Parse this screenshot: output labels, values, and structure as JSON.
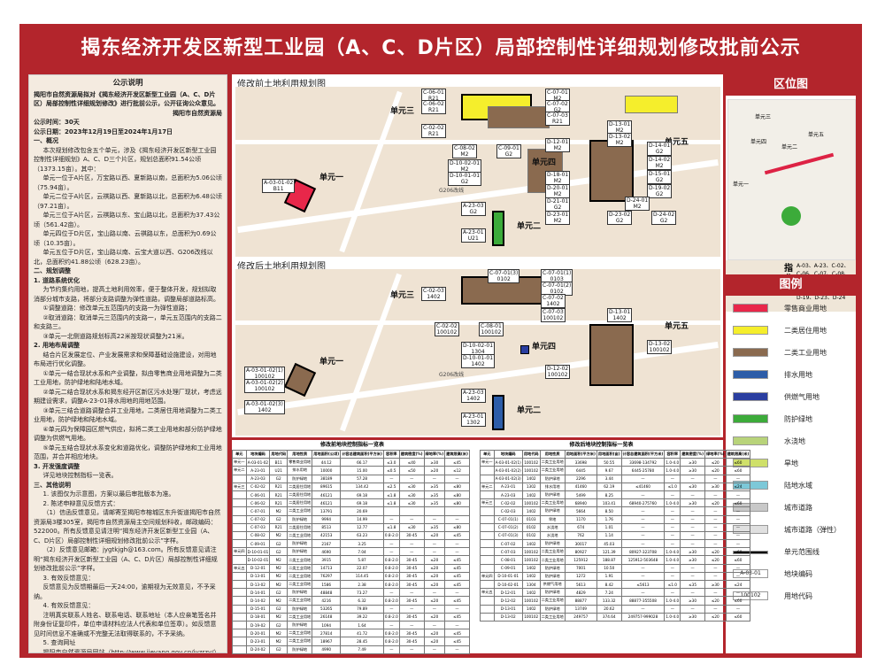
{
  "title": "揭东经济开发区新型工业园（A、C、D片区）局部控制性详细规划修改批前公示",
  "notice": {
    "heading": "公示说明",
    "intro": "揭阳市自然资源局拟对《揭东经济开发区新型工业园（A、C、D片区）局部控制性详细规划修改》进行批前公示，公开征询公众意见。",
    "issuer": "揭阳市自然资源局",
    "period_label": "公示时间：30天",
    "deadline": "公示日期：2023年12月19日至2024年1月17日",
    "sections": [
      {
        "h": "一、概况",
        "lines": [
          "本次规划修改包含五个单元，涉及《揭东经济开发区新型工业园控制性详细规划》A、C、D三个片区，规划总面积91.54公顷（1373.15亩）。其中：",
          "单元一位于A片区，万宝路以西、夏新路以南，总面积为5.06公顷（75.94亩）。",
          "单元二位于A片区，云祺路以西、夏新路以北，总面积为6.48公顷（97.21亩）。",
          "单元三位于A片区，云祺路以东、宝山路以北，总面积为37.43公顷（561.42亩）。",
          "单元四位于D片区，宝山路以南、云祺路以东，总面积为0.69公顷（10.35亩）。",
          "单元五位于D片区，宝山路以南、云宝大道以西、G206改线以北，总面积约41.88公顷（628.23亩）。"
        ]
      },
      {
        "h": "二、规划调整",
        "lines": []
      },
      {
        "h": "1. 道路系统优化",
        "lines": [
          "为节约集约用地，提高土地利用效率，便于整体开发，规划拟取消部分城市支路，将部分支路调整为弹性道路，调整局部道路标高。",
          "①调整道路：修改单元五范围内的支路一为弹性道路；",
          "②取消道路：取消单元三范围内的支路一，单元五范围内的支路二和支路三。",
          "③单元一北侧道路规划标高22米按现状调整为21米。"
        ]
      },
      {
        "h": "2. 用地布局调整",
        "lines": [
          "结合片区发展定位、产业发展需求和保障基础设施建设，对用地布局进行优化调整。",
          "①单元一结合现状水系和产业调整，拟由零售商业用地调整为二类工业用地，防护绿地和陆地水域。",
          "②单元二结合现状水系和揭东经开区新区污水处理厂现状，考虑远期建设需求，调整A-23-01排水用地的用地范围。",
          "③单元三结合道路调整合并工业用地，二类居住用地调整为二类工业用地，防护绿地和陆地水域。",
          "④单元四为保障园区燃气供应，拟将二类工业用地和部分防护绿地调整为供燃气用地。",
          "⑤单元五结合现状水系变化和道路优化，调整防护绿地和工业用地范围，并合并相应地块。"
        ]
      },
      {
        "h": "3. 开发强度调整",
        "lines": [
          "详见地块控制指标一览表。"
        ]
      },
      {
        "h": "三、其他说明",
        "lines": [
          "1. 该图仅为示意图，方案以最后审批版本为准。",
          "2. 陈述申辩意见反馈方式：",
          "（1）信函反馈意见，请邮寄至揭阳市榕城区东升街道揭阳市自然资源局3楼305室，揭阳市自然资源局主空间规划科收，邮政编码：522000。所有反馈意见请注明“揭东经济开发区新型工业园（A、C、D片区）局部控制性详细规划修改批前公示”字样。",
          "（2）反馈意见邮箱：jygtkjgh@163.com。所有反馈意见请注明“揭东经济开发区新型工业园（A、C、D片区）局部控制性详细规划修改批前公示”字样。",
          "3. 有效反馈意见：",
          "反馈意见为反馈期最后一天24:00，逾期视为无效意见，不予采纳。",
          "4. 有效反馈意见：",
          "注明真实联系人姓名、联系电话、联系地址（本人应亲笔签名并附身份证复印件，单位申请材料应法人代表和单位签章）。如反馈意见时间信息不准确或不完整无法取得联系的，不予采纳。",
          "5. 查询网址",
          "揭阳市自然资源局网站（http://www.jieyang.gov.cn/jyzrzy/）",
          "6. 本期公示图纸共1张，即本图。"
        ]
      }
    ]
  },
  "map_before": {
    "title": "修改前土地利用规划图",
    "units": [
      "单元一",
      "单元二",
      "单元三",
      "单元四",
      "单元五"
    ],
    "labels": [
      "C-06-01\nR21",
      "C-06-02\nR21",
      "C-02-02\nR21",
      "C-08-02\nM2",
      "C-09-01\nG2",
      "C-07-01\nM2",
      "C-07-02\nG2",
      "C-07-03\nR21",
      "D-13-01\nM2",
      "D-13-02\nM2",
      "D-14-01\nG2",
      "D-14-02\nM2",
      "D-12-01\nM2",
      "D-10-02-01\nM2",
      "D-10-01-01\nG2",
      "D-15-01\nG2",
      "D-19-02\nG2",
      "D-18-01\nM2",
      "D-20-01\nM2",
      "D-21-01\nG2",
      "D-23-01\nM2",
      "D-23-02\nG2",
      "D-24-01\nM2",
      "D-24-02\nG2",
      "A-03-01-02\nB11",
      "A-23-03\nG2",
      "A-23-01\nU21"
    ],
    "road": "G206改线"
  },
  "map_after": {
    "title": "修改后土地利用规划图",
    "units": [
      "单元一",
      "单元二",
      "单元三",
      "单元四",
      "单元五"
    ],
    "labels": [
      "C-07-01(3)\n0102",
      "C-07-01(1)\n0103",
      "C-02-03\n1402",
      "C-07-01(2)\n0102",
      "C-07-02\n1402",
      "C-07-03\n100102",
      "C-08-01\n100102",
      "C-02-02\n100102",
      "D-13-01\n1402",
      "D-13-02\n100102",
      "D-10-02-01\n1304",
      "D-10-01-01\n1402",
      "D-12-02\n100102",
      "A-03-01-02(1)\n100102",
      "A-03-01-02(2)\n100102",
      "A-03-01-02(3)\n1402",
      "A-23-03\n1402",
      "A-23-01\n1302"
    ],
    "road": "G206改线"
  },
  "location": {
    "title": "区位图",
    "units": [
      "单元三",
      "单元五",
      "单元二",
      "单元四",
      "单元一"
    ],
    "code_label": "编码",
    "north_label": "指北针",
    "codes": "A-03、A-23、C-02、C-06、C-07、C-08、C-09、D-10、D-12、D-13、D-14、D-18、D-19、D-23、D-24"
  },
  "legend": {
    "title": "图例",
    "items": [
      {
        "label": "零售商业用地",
        "color": "#e8274a"
      },
      {
        "label": "二类居住用地",
        "color": "#f5ee2c"
      },
      {
        "label": "二类工业用地",
        "color": "#8a6a4f"
      },
      {
        "label": "排水用地",
        "color": "#2d5da8"
      },
      {
        "label": "供燃气用地",
        "color": "#2a3ea0"
      },
      {
        "label": "防护绿地",
        "color": "#3cab3a"
      },
      {
        "label": "水浇地",
        "color": "#b8d37a"
      },
      {
        "label": "旱地",
        "color": "#cfe06a"
      },
      {
        "label": "陆地水域",
        "color": "#7dc8d8"
      },
      {
        "label": "城市道路",
        "color": "#c8c8c8"
      },
      {
        "label": "城市道路（弹性）",
        "color": "#e0e0e0"
      },
      {
        "label": "单元范围线",
        "color": "#000000"
      },
      {
        "label": "地块编码",
        "sample": "A-03-01"
      },
      {
        "label": "用地代码",
        "sample": "100102"
      }
    ]
  },
  "table_before": {
    "caption": "修改前地块控制指标一览表",
    "headers": [
      "单元",
      "地块编码",
      "用地代码",
      "用地性质",
      "用地面积(公顷)",
      "计容总建筑面积(平方米)",
      "容积率",
      "建筑密度(%)",
      "绿地率(%)",
      "建筑限高(米)"
    ],
    "rows": [
      [
        "单元一",
        "A-03-01-02",
        "B11",
        "零售商业用地",
        "44.12",
        "66.17",
        "≤3.0",
        "≤40",
        "≥30",
        "≤45"
      ],
      [
        "单元二",
        "A-23-01",
        "U21",
        "排水用地",
        "10000",
        "15.00",
        "≤0.5",
        "≤50",
        "≥20",
        "≤12"
      ],
      [
        "",
        "A-23-03",
        "G2",
        "防护绿地",
        "38189",
        "57.28",
        "—",
        "—",
        "—",
        "—"
      ],
      [
        "单元三",
        "C-02-02",
        "R21",
        "二类居住用地",
        "89615",
        "134.42",
        "≤2.5",
        "≤30",
        "≥35",
        "≤80"
      ],
      [
        "",
        "C-06-01",
        "R21",
        "二类居住用地",
        "46121",
        "69.18",
        "≤1.8",
        "≤30",
        "≥35",
        "≤80"
      ],
      [
        "",
        "C-06-02",
        "R21",
        "二类居住用地",
        "46121",
        "69.18",
        "≤1.8",
        "≤30",
        "≥35",
        "≤80"
      ],
      [
        "",
        "C-07-01",
        "M2",
        "二类工业用地",
        "13791",
        "20.69",
        "",
        "",
        "",
        ""
      ],
      [
        "",
        "C-07-02",
        "G2",
        "防护绿地",
        "9994",
        "14.99",
        "—",
        "—",
        "—",
        "—"
      ],
      [
        "",
        "C-07-03",
        "R21",
        "二类居住用地",
        "8513",
        "12.77",
        "≤1.8",
        "≤30",
        "≥35",
        "≤80"
      ],
      [
        "",
        "C-08-02",
        "M2",
        "二类工业用地",
        "42153",
        "63.23",
        "0.8-2.0",
        "30-45",
        "≤20",
        "≤45"
      ],
      [
        "",
        "C-09-01",
        "G2",
        "防护绿地",
        "2167",
        "3.25",
        "—",
        "—",
        "—",
        "—"
      ],
      [
        "单元四",
        "D-10-01-01",
        "G2",
        "防护绿地",
        "4690",
        "7.04",
        "—",
        "—",
        "—",
        "—"
      ],
      [
        "",
        "D-10-02-01",
        "M2",
        "二类工业用地",
        "3915",
        "5.87",
        "0.8-2.0",
        "30-45",
        "≤20",
        "≤45"
      ],
      [
        "单元五",
        "D-12-01",
        "M2",
        "二类工业用地",
        "14713",
        "22.07",
        "0.8-2.0",
        "30-45",
        "≤20",
        "≤45"
      ],
      [
        "",
        "D-13-01",
        "M2",
        "二类工业用地",
        "76297",
        "114.45",
        "0.8-2.0",
        "30-45",
        "≤20",
        "≤45"
      ],
      [
        "",
        "D-13-02",
        "M2",
        "二类工业用地",
        "1586",
        "2.38",
        "0.8-2.0",
        "30-45",
        "≤20",
        "≤45"
      ],
      [
        "",
        "D-14-01",
        "G2",
        "防护绿地",
        "48848",
        "73.27",
        "—",
        "—",
        "—",
        "—"
      ],
      [
        "",
        "D-14-02",
        "M2",
        "二类工业用地",
        "4216",
        "6.32",
        "0.8-2.0",
        "30-45",
        "≤20",
        "≤45"
      ],
      [
        "",
        "D-15-01",
        "G2",
        "防护绿地",
        "53265",
        "79.89",
        "—",
        "—",
        "—",
        "—"
      ],
      [
        "",
        "D-18-01",
        "M2",
        "二类工业用地",
        "26148",
        "39.22",
        "0.8-2.0",
        "30-45",
        "≤20",
        "≤45"
      ],
      [
        "",
        "D-19-02",
        "G2",
        "防护绿地",
        "1094",
        "1.64",
        "—",
        "—",
        "—",
        "—"
      ],
      [
        "",
        "D-20-01",
        "M2",
        "二类工业用地",
        "27814",
        "41.72",
        "0.8-2.0",
        "30-45",
        "≤20",
        "≤45"
      ],
      [
        "",
        "D-23-01",
        "M2",
        "二类工业用地",
        "18967",
        "28.45",
        "0.8-2.0",
        "30-45",
        "≤20",
        "≤45"
      ],
      [
        "",
        "D-24-02",
        "G2",
        "防护绿地",
        "4990",
        "7.49",
        "—",
        "—",
        "—",
        "—"
      ]
    ]
  },
  "table_after": {
    "caption": "修改后地块控制指标一览表",
    "headers": [
      "单元",
      "地块编码",
      "用地代码",
      "用地性质",
      "用地面积(平方米)",
      "用地面积(亩)",
      "计容总建筑面积(平方米)",
      "容积率",
      "建筑密度(%)",
      "绿地率(%)",
      "建筑限高(米)"
    ],
    "rows": [
      [
        "单元一",
        "A-03-01-02(1)",
        "100102",
        "二类工业用地",
        "33698",
        "50.55",
        "33698-134792",
        "1.0-4.0",
        "≥30",
        "≤20",
        "≤60"
      ],
      [
        "",
        "A-03-01-02(2)",
        "100102",
        "二类工业用地",
        "6445",
        "9.67",
        "6445-25780",
        "1.0-4.0",
        "≥30",
        "≤20",
        "≤60"
      ],
      [
        "",
        "A-03-01-02(3)",
        "1402",
        "防护绿地",
        "2296",
        "3.44",
        "—",
        "—",
        "—",
        "—",
        "—"
      ],
      [
        "单元二",
        "A-23-01",
        "1302",
        "排水用地",
        "41460",
        "62.19",
        "≤41460",
        "≤1.0",
        "≤30",
        "≥30",
        "≤24"
      ],
      [
        "",
        "A-23-03",
        "1402",
        "防护绿地",
        "5499",
        "8.25",
        "—",
        "—",
        "—",
        "—",
        "—"
      ],
      [
        "单元三",
        "C-02-02",
        "100102",
        "二类工业用地",
        "68940",
        "103.41",
        "68940-275760",
        "1.0-4.0",
        "≥30",
        "≤20",
        "≤60"
      ],
      [
        "",
        "C-02-03",
        "1402",
        "防护绿地",
        "5664",
        "8.50",
        "—",
        "—",
        "—",
        "—",
        "—"
      ],
      [
        "",
        "C-07-01(1)",
        "0103",
        "旱地",
        "1170",
        "1.76",
        "—",
        "—",
        "—",
        "—",
        "—"
      ],
      [
        "",
        "C-07-01(2)",
        "0102",
        "水浇地",
        "674",
        "1.01",
        "—",
        "—",
        "—",
        "—",
        "—"
      ],
      [
        "",
        "C-07-01(3)",
        "0102",
        "水浇地",
        "762",
        "1.14",
        "—",
        "—",
        "—",
        "—",
        "—"
      ],
      [
        "",
        "C-07-02",
        "1402",
        "防护绿地",
        "30017",
        "45.03",
        "—",
        "—",
        "—",
        "—",
        "—"
      ],
      [
        "",
        "C-07-03",
        "100102",
        "二类工业用地",
        "80927",
        "121.39",
        "80927-323708",
        "1.0-4.0",
        "≥30",
        "≤20",
        "≤60"
      ],
      [
        "",
        "C-08-01",
        "100102",
        "二类工业用地",
        "125912",
        "188.87",
        "125912-503648",
        "1.0-4.0",
        "≥30",
        "≤20",
        "≤60"
      ],
      [
        "",
        "C-09-01",
        "1402",
        "防护绿地",
        "7001",
        "10.50",
        "—",
        "—",
        "—",
        "—",
        "—"
      ],
      [
        "单元四",
        "D-10-01-01",
        "1402",
        "防护绿地",
        "1272",
        "1.91",
        "—",
        "—",
        "—",
        "—",
        "—"
      ],
      [
        "",
        "D-10-02-01",
        "1304",
        "供燃气用地",
        "5613",
        "8.42",
        "≤5613",
        "≤1.0",
        "≤35",
        "≥30",
        "≤24"
      ],
      [
        "单元五",
        "D-12-01",
        "1402",
        "防护绿地",
        "4829",
        "7.24",
        "—",
        "—",
        "—",
        "—",
        "—"
      ],
      [
        "",
        "D-12-02",
        "100102",
        "二类工业用地",
        "88877",
        "133.32",
        "88877-355508",
        "1.0-4.0",
        "≥30",
        "≤20",
        "≤60"
      ],
      [
        "",
        "D-13-01",
        "1402",
        "防护绿地",
        "13749",
        "20.62",
        "—",
        "—",
        "—",
        "—",
        "—"
      ],
      [
        "",
        "D-13-02",
        "100102",
        "二类工业用地",
        "249757",
        "374.64",
        "249757-999028",
        "1.0-4.0",
        "≥30",
        "≤20",
        "≤60"
      ]
    ]
  }
}
